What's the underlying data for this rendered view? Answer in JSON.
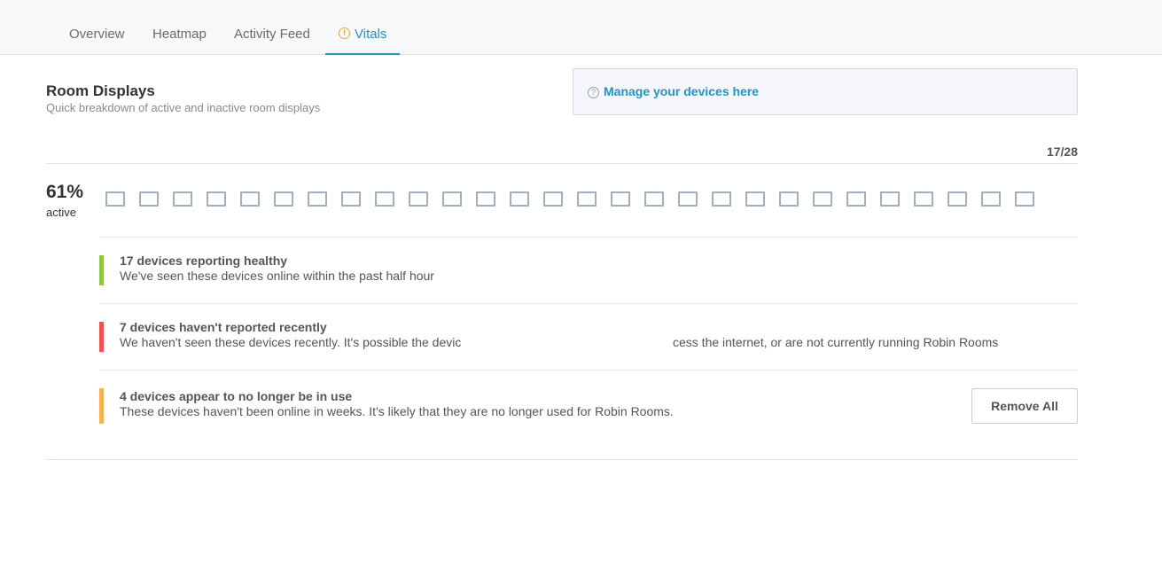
{
  "tabs": [
    {
      "label": "Overview"
    },
    {
      "label": "Heatmap"
    },
    {
      "label": "Activity Feed"
    },
    {
      "label": "Vitals",
      "active": true,
      "icon": "warning-icon"
    }
  ],
  "section": {
    "title": "Room Displays",
    "subtitle": "Quick breakdown of active and inactive room displays"
  },
  "manage": {
    "icon": "help-icon",
    "link_label": "Manage your devices here"
  },
  "summary": {
    "count": "17/28",
    "percent": "61%",
    "percent_label": "active",
    "device_count": 28
  },
  "statuses": [
    {
      "title": "17 devices reporting healthy",
      "description": "We've seen these devices online within the past half hour",
      "color": "#8dc63f"
    },
    {
      "title": "7 devices haven't reported recently",
      "description_left": "We haven't seen these devices recently. It's possible the devic",
      "description_right": "cess the internet, or are not currently running Robin Rooms",
      "color": "#f0514f"
    },
    {
      "title": "4 devices appear to no longer be in use",
      "description": "These devices haven't been online in weeks. It's likely that they are no longer used for Robin Rooms.",
      "color": "#f5b04f"
    }
  ],
  "actions": {
    "remove_all_label": "Remove All"
  }
}
